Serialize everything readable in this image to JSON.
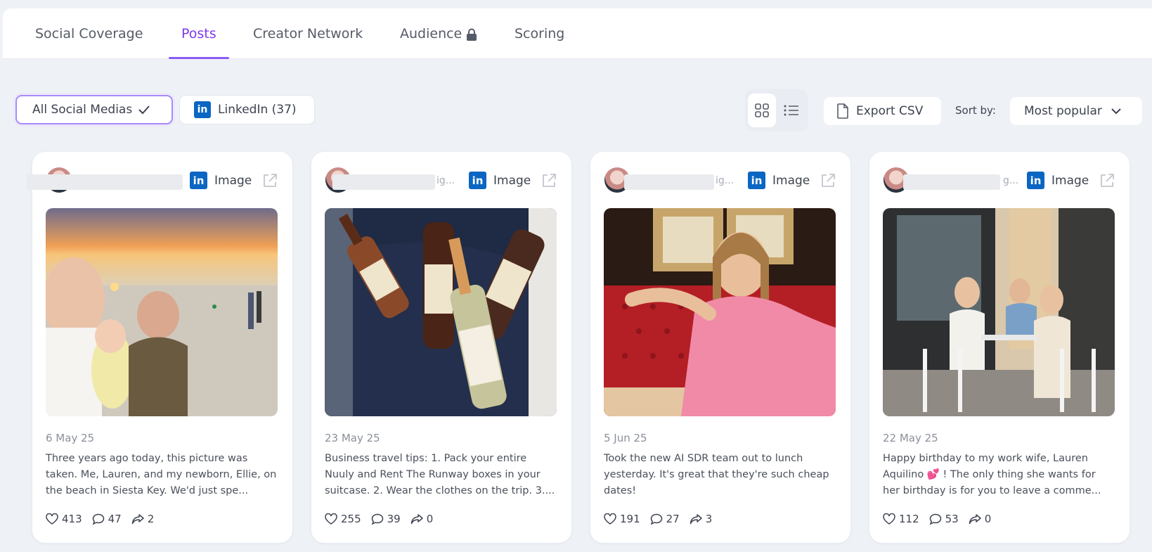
{
  "tabs": [
    {
      "label": "Social Coverage"
    },
    {
      "label": "Posts"
    },
    {
      "label": "Creator Network"
    },
    {
      "label": "Audience"
    },
    {
      "label": "Scoring"
    }
  ],
  "active_tab": "Posts",
  "filters": {
    "all_label": "All Social Medias",
    "linkedin_label": "LinkedIn (37)",
    "linkedin_icon_text": "in"
  },
  "toolbar": {
    "export_label": "Export CSV",
    "sort_label": "Sort by:",
    "sort_value": "Most popular"
  },
  "accent_color": "#7c3aed",
  "linkedin_color": "#0a66c2",
  "posts": [
    {
      "name_tail": "",
      "content_type": "Image",
      "date": "6 May 25",
      "text": "Three years ago today, this picture was taken. Me, Lauren, and my newborn, Ellie, on the beach in Siesta Key. We'd just spe...",
      "likes": "413",
      "comments": "47",
      "shares": "2"
    },
    {
      "name_tail": "ig...",
      "content_type": "Image",
      "date": "23 May 25",
      "text": "Business travel tips: 1. Pack your entire Nuuly and Rent The Runway boxes in your suitcase. 2. Wear the clothes on the trip. 3....",
      "likes": "255",
      "comments": "39",
      "shares": "0"
    },
    {
      "name_tail": "ig...",
      "content_type": "Image",
      "date": "5 Jun 25",
      "text": "Took the new AI SDR team out to lunch yesterday. It's great that they're such cheap dates!",
      "likes": "191",
      "comments": "27",
      "shares": "3"
    },
    {
      "name_tail": "g...",
      "content_type": "Image",
      "date": "22 May 25",
      "text": "Happy birthday to my work wife, Lauren Aquilino 💕 ! The only thing she wants for her birthday is for you to leave a comme...",
      "likes": "112",
      "comments": "53",
      "shares": "0"
    }
  ]
}
